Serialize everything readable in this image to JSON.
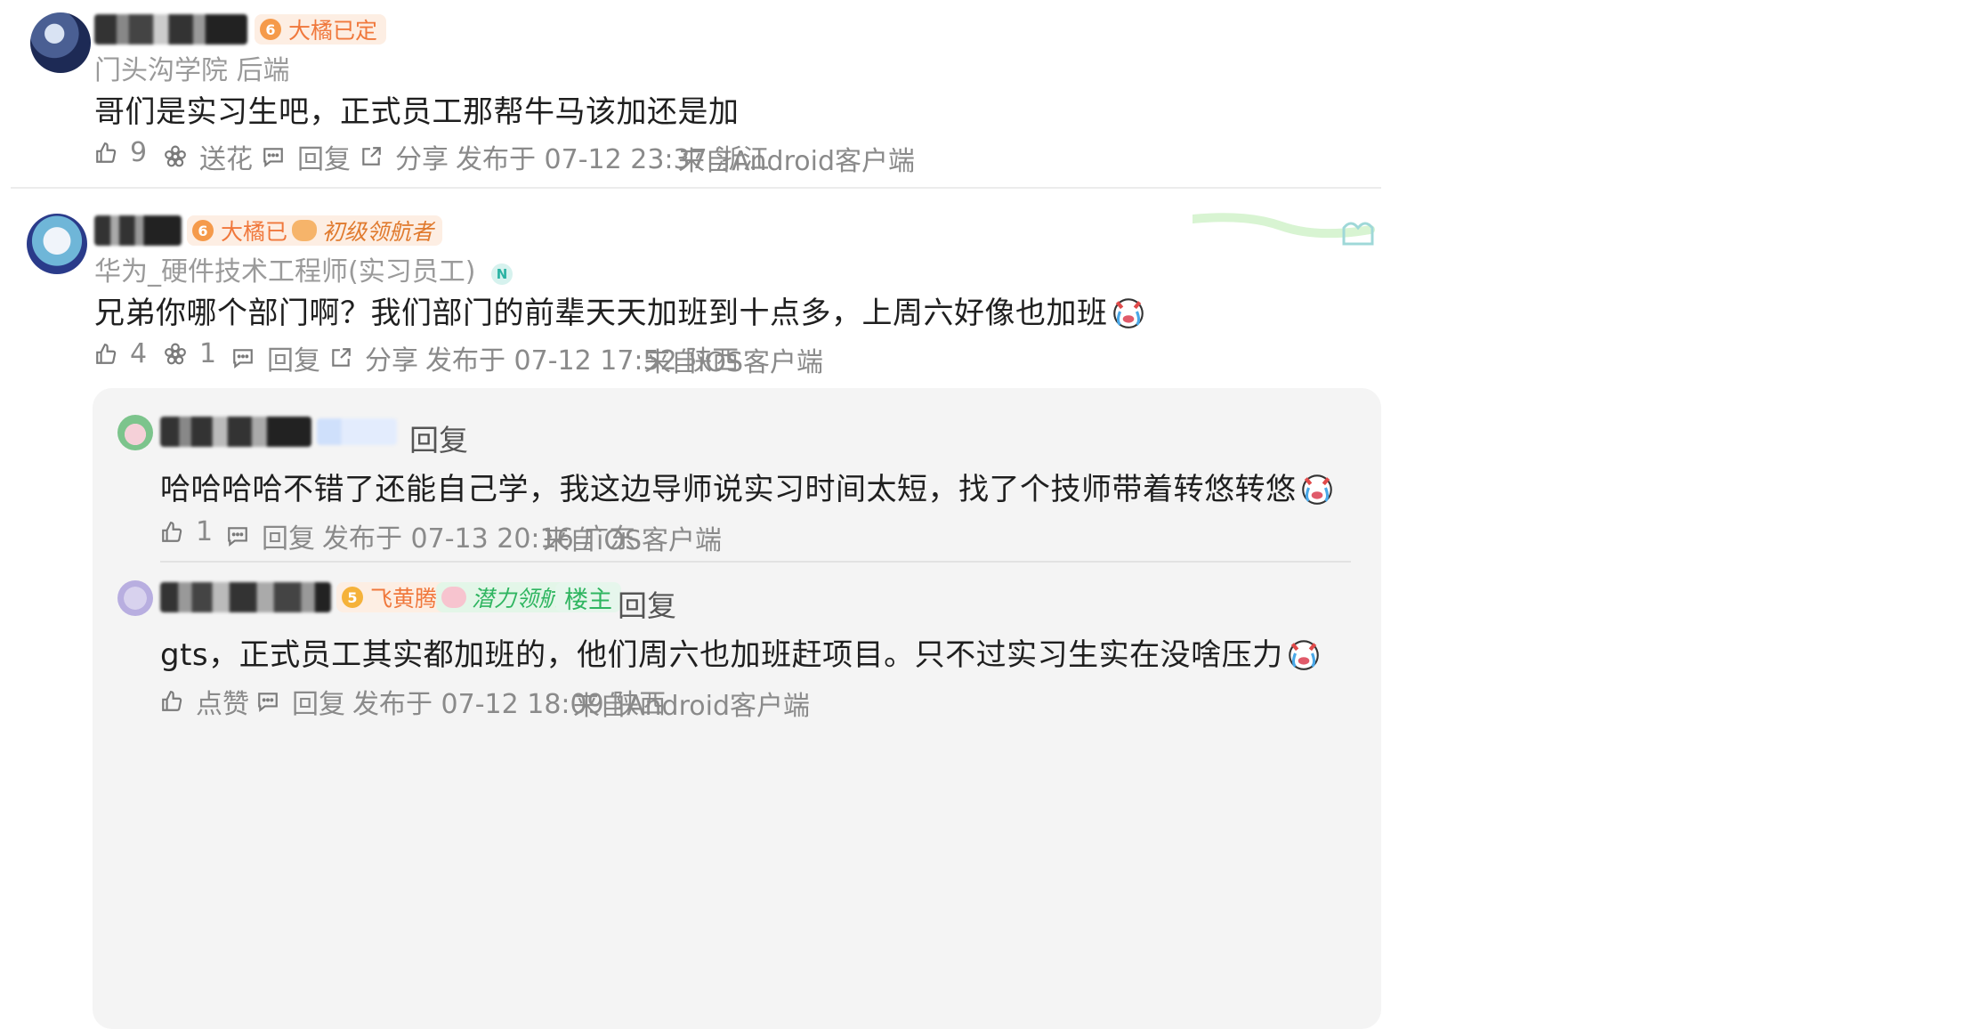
{
  "comments": [
    {
      "badge": "大橘已定",
      "badge_level": "6",
      "subtitle": "门头沟学院 后端",
      "text": "哥们是实习生吧，正式员工那帮牛马该加还是加",
      "like_count": "9",
      "flower_label": "送花",
      "reply_label": "回复",
      "share_label": "分享",
      "published": "发布于 07-12 23:37 浙江",
      "source": "来自Android客户端"
    },
    {
      "badge": "大橘已定",
      "badge_level": "6",
      "badge2": "初级领航者",
      "subtitle": "华为_硬件技术工程师(实习员工)",
      "text": "兄弟你哪个部门啊？我们部门的前辈天天加班到十点多，上周六好像也加班",
      "like_count": "4",
      "flower_count": "1",
      "reply_label": "回复",
      "share_label": "分享",
      "published": "发布于 07-12 17:52 陕西",
      "source": "来自iOS客户端"
    }
  ],
  "replies": [
    {
      "reply_label": "回复",
      "text": "哈哈哈哈不错了还能自己学，我这边导师说实习时间太短，找了个技师带着转悠转悠",
      "like_count": "1",
      "action_reply": "回复",
      "published": "发布于 07-13 20:16 广东",
      "source": "来自iOS客户端"
    },
    {
      "badge": "飞黄腾达",
      "badge_level": "5",
      "badge2": "潜力领航者",
      "owner_tag": "楼主",
      "reply_label": "回复",
      "text": "gts，正式员工其实都加班的，他们周六也加班赶项目。只不过实习生实在没啥压力",
      "like_label": "点赞",
      "action_reply": "回复",
      "published": "发布于 07-12 18:09 陕西",
      "source": "来自Android客户端"
    }
  ],
  "colors": {
    "orange_badge_bg": "#fdeee3",
    "orange_badge_text": "#f0783c",
    "green_badge_bg": "#e3f6e8",
    "green_badge_text": "#2fb560",
    "owner_tag_bg": "#e6f6ec",
    "owner_tag_text": "#2fb560",
    "reply_bg": "#f4f4f4"
  }
}
